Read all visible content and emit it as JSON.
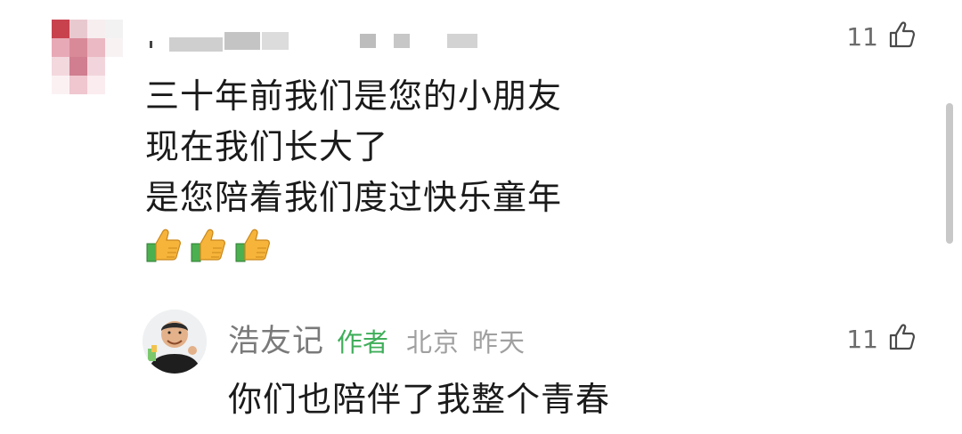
{
  "comment": {
    "likes": "11",
    "lines": [
      "三十年前我们是您的小朋友",
      "现在我们长大了",
      "是您陪着我们度过快乐童年"
    ],
    "emoji_icons": [
      "thumbs-up-icon",
      "thumbs-up-icon",
      "thumbs-up-icon"
    ]
  },
  "reply": {
    "author": "浩友记",
    "badge": "作者",
    "location": "北京",
    "time": "昨天",
    "likes": "11",
    "text": "你们也陪伴了我整个青春"
  },
  "colors": {
    "author_badge": "#3fae5a",
    "meta_gray": "#a0a0a0",
    "like_gray": "#6b6b6b"
  }
}
